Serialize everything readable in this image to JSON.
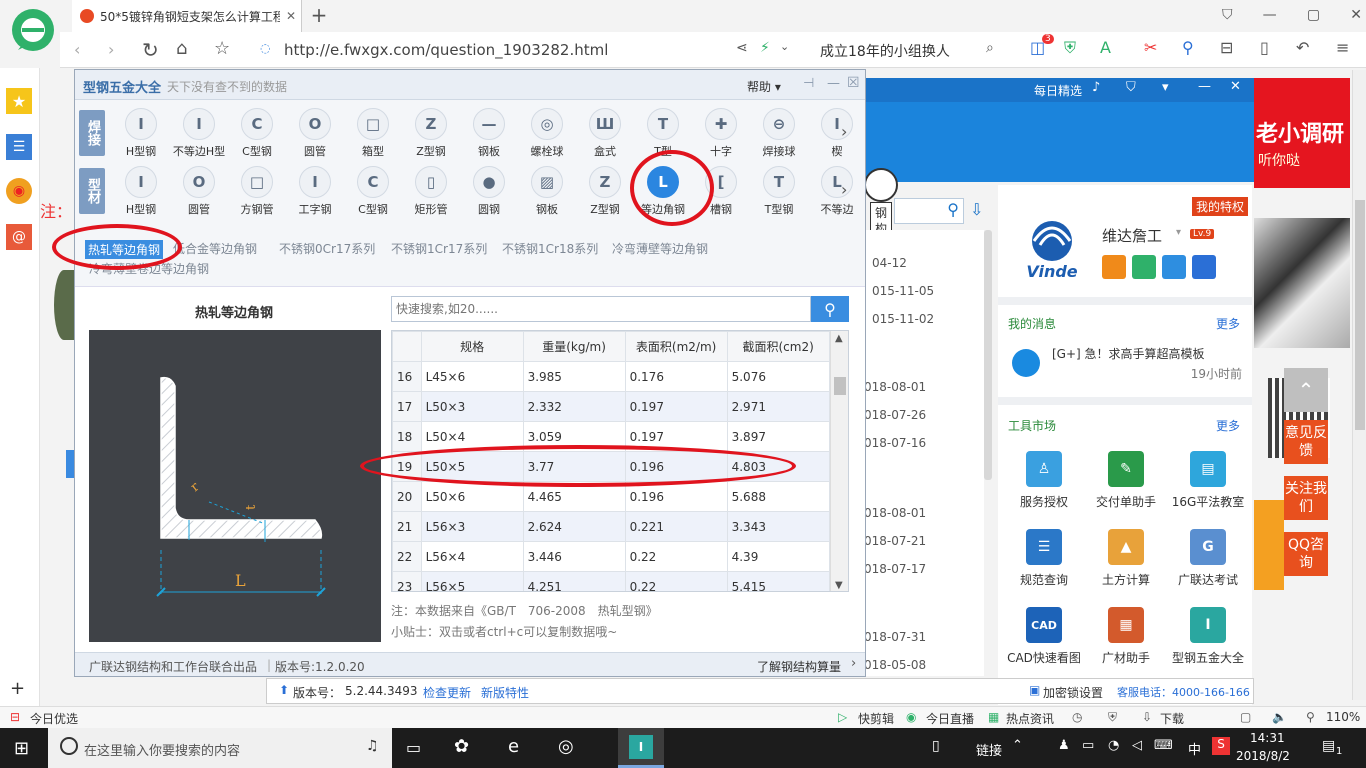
{
  "browser": {
    "tab_title": "50*5镀锌角钢短支架怎么计算工程",
    "url": "http://e.fwxgx.com/question_1903282.html",
    "search_text": "成立18年的小组换人",
    "nav_badge": "3",
    "status_left": "今日优选",
    "status_items": [
      "快剪辑",
      "今日直播",
      "热点资讯",
      "下载"
    ],
    "zoom": "110%"
  },
  "page_bg": {
    "note_label": "注：",
    "dates": [
      "04-12",
      "015-11-05",
      "015-11-02",
      "018-08-01",
      "018-07-26",
      "018-07-16",
      "018-08-01",
      "018-07-21",
      "018-07-17",
      "018-07-31",
      "018-05-08"
    ],
    "banner_text": "老小调研",
    "banner_sub": "听你哒",
    "float_buttons": [
      "意见反馈",
      "关注我们",
      "QQ咨询"
    ]
  },
  "dialog": {
    "title": "型钢五金大全",
    "subtitle": "天下没有查不到的数据",
    "help_label": "帮助",
    "row1_side": "焊接",
    "row2_side": "型材",
    "row1_items": [
      {
        "label": "H型钢",
        "glyph": "I"
      },
      {
        "label": "不等边H型",
        "glyph": "I"
      },
      {
        "label": "C型钢",
        "glyph": "C"
      },
      {
        "label": "圆管",
        "glyph": "O"
      },
      {
        "label": "箱型",
        "glyph": "□"
      },
      {
        "label": "Z型钢",
        "glyph": "Z"
      },
      {
        "label": "钢板",
        "glyph": "—"
      },
      {
        "label": "螺栓球",
        "glyph": "◎"
      },
      {
        "label": "盒式",
        "glyph": "Ш"
      },
      {
        "label": "T型",
        "glyph": "T"
      },
      {
        "label": "十字",
        "glyph": "✚"
      },
      {
        "label": "焊接球",
        "glyph": "⊖"
      },
      {
        "label": "楔",
        "glyph": "I"
      }
    ],
    "row2_items": [
      {
        "label": "H型钢",
        "glyph": "I"
      },
      {
        "label": "圆管",
        "glyph": "O"
      },
      {
        "label": "方钢管",
        "glyph": "□"
      },
      {
        "label": "工字钢",
        "glyph": "I"
      },
      {
        "label": "C型钢",
        "glyph": "C"
      },
      {
        "label": "矩形管",
        "glyph": "▯"
      },
      {
        "label": "圆钢",
        "glyph": "●"
      },
      {
        "label": "钢板",
        "glyph": "▨"
      },
      {
        "label": "Z型钢",
        "glyph": "Z"
      },
      {
        "label": "等边角钢",
        "glyph": "L"
      },
      {
        "label": "槽钢",
        "glyph": "["
      },
      {
        "label": "T型钢",
        "glyph": "T"
      },
      {
        "label": "不等边",
        "glyph": "L"
      }
    ],
    "sub_tabs": [
      "热轧等边角钢",
      "低合金等边角钢",
      "不锈钢0Cr17系列",
      "不锈钢1Cr17系列",
      "不锈钢1Cr18系列",
      "冷弯薄壁等边角钢",
      "冷弯薄壁卷边等边角钢"
    ],
    "figure_title": "热轧等边角钢",
    "figure_label_L": "L",
    "figure_label_r": "r",
    "figure_label_t": "t",
    "search_placeholder": "快速搜索,如20......",
    "table": {
      "headers": [
        "规格",
        "重量(kg/m)",
        "表面积(m2/m)",
        "截面积(cm2)"
      ],
      "rows": [
        [
          "16",
          "L45×6",
          "3.985",
          "0.176",
          "5.076"
        ],
        [
          "17",
          "L50×3",
          "2.332",
          "0.197",
          "2.971"
        ],
        [
          "18",
          "L50×4",
          "3.059",
          "0.197",
          "3.897"
        ],
        [
          "19",
          "L50×5",
          "3.77",
          "0.196",
          "4.803"
        ],
        [
          "20",
          "L50×6",
          "4.465",
          "0.196",
          "5.688"
        ],
        [
          "21",
          "L56×3",
          "2.624",
          "0.221",
          "3.343"
        ],
        [
          "22",
          "L56×4",
          "3.446",
          "0.22",
          "4.39"
        ],
        [
          "23",
          "L56×5",
          "4.251",
          "0.22",
          "5.415"
        ]
      ]
    },
    "note1": "注：本数据来自《GB/T　706-2008　热轧型钢》",
    "note2": "小贴士：双击或者ctrl+c可以复制数据哦~",
    "footer_left": "广联达钢结构和工作台联合出品",
    "footer_version": "版本号:1.2.0.20",
    "footer_right": "了解钢结构算量"
  },
  "app_panel": {
    "topbar_text": "每日精选",
    "mascot_text": "钢构软件",
    "user_name": "维达詹工",
    "level": "Lv.9",
    "privilege": "我的特权",
    "logo_text": "Vinde",
    "messages_title": "我的消息",
    "more": "更多",
    "message_text": "[G+] 急！求高手算超高模板",
    "message_time": "19小时前",
    "tools_title": "工具市场",
    "tools": [
      {
        "label": "服务授权",
        "color": "#3aa0e0",
        "glyph": "♙"
      },
      {
        "label": "交付单助手",
        "color": "#2a9a4a",
        "glyph": "✎"
      },
      {
        "label": "16G平法教室",
        "color": "#2ea6dc",
        "glyph": "▤"
      },
      {
        "label": "规范查询",
        "color": "#2b78c8",
        "glyph": "☰"
      },
      {
        "label": "土方计算",
        "color": "#e8a23a",
        "glyph": "▲"
      },
      {
        "label": "广联达考试",
        "color": "#5a8fd0",
        "glyph": "G"
      },
      {
        "label": "CAD快速看图",
        "color": "#1d63b8",
        "glyph": "CAD"
      },
      {
        "label": "广材助手",
        "color": "#d35a2c",
        "glyph": "▦"
      },
      {
        "label": "型钢五金大全",
        "color": "#2aa7a0",
        "glyph": "I"
      }
    ],
    "version_label": "版本号：",
    "version": "5.2.44.3493",
    "check_update": "检查更新",
    "new_features": "新版特性",
    "lock_settings": "加密锁设置",
    "service_phone": "客服电话：4000-166-166"
  },
  "taskbar": {
    "search_placeholder": "在这里输入你要搜索的内容",
    "tray_link": "链接",
    "ime": "中",
    "time": "14:31",
    "date": "2018/8/2",
    "notif_count": "1"
  }
}
